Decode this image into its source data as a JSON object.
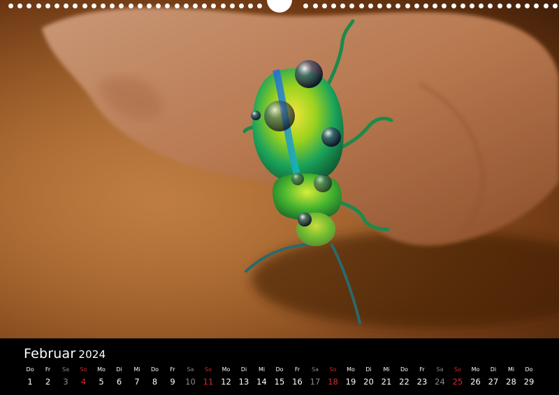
{
  "calendar": {
    "month": "Februar",
    "year": "2024",
    "colors": {
      "weekday": "#ffffff",
      "saturday": "#8a8a8a",
      "sunday": "#d8292b"
    },
    "days": [
      {
        "wd": "Do",
        "n": "1",
        "t": "w"
      },
      {
        "wd": "Fr",
        "n": "2",
        "t": "w"
      },
      {
        "wd": "Sa",
        "n": "3",
        "t": "sat"
      },
      {
        "wd": "So",
        "n": "4",
        "t": "sun"
      },
      {
        "wd": "Mo",
        "n": "5",
        "t": "w"
      },
      {
        "wd": "Di",
        "n": "6",
        "t": "w"
      },
      {
        "wd": "Mi",
        "n": "7",
        "t": "w"
      },
      {
        "wd": "Do",
        "n": "8",
        "t": "w"
      },
      {
        "wd": "Fr",
        "n": "9",
        "t": "w"
      },
      {
        "wd": "Sa",
        "n": "10",
        "t": "sat"
      },
      {
        "wd": "So",
        "n": "11",
        "t": "sun"
      },
      {
        "wd": "Mo",
        "n": "12",
        "t": "w"
      },
      {
        "wd": "Di",
        "n": "13",
        "t": "w"
      },
      {
        "wd": "Mi",
        "n": "14",
        "t": "w"
      },
      {
        "wd": "Do",
        "n": "15",
        "t": "w"
      },
      {
        "wd": "Fr",
        "n": "16",
        "t": "w"
      },
      {
        "wd": "Sa",
        "n": "17",
        "t": "sat"
      },
      {
        "wd": "So",
        "n": "18",
        "t": "sun"
      },
      {
        "wd": "Mo",
        "n": "19",
        "t": "w"
      },
      {
        "wd": "Di",
        "n": "20",
        "t": "w"
      },
      {
        "wd": "Mi",
        "n": "21",
        "t": "w"
      },
      {
        "wd": "Do",
        "n": "22",
        "t": "w"
      },
      {
        "wd": "Fr",
        "n": "23",
        "t": "w"
      },
      {
        "wd": "Sa",
        "n": "24",
        "t": "sat"
      },
      {
        "wd": "So",
        "n": "25",
        "t": "sun"
      },
      {
        "wd": "Mo",
        "n": "26",
        "t": "w"
      },
      {
        "wd": "Di",
        "n": "27",
        "t": "w"
      },
      {
        "wd": "Mi",
        "n": "28",
        "t": "w"
      },
      {
        "wd": "Do",
        "n": "29",
        "t": "w"
      }
    ]
  },
  "photo": {
    "subject": "iridescent-beetle",
    "colors": {
      "bark": "#c08560",
      "background": "#9a5a26"
    }
  }
}
